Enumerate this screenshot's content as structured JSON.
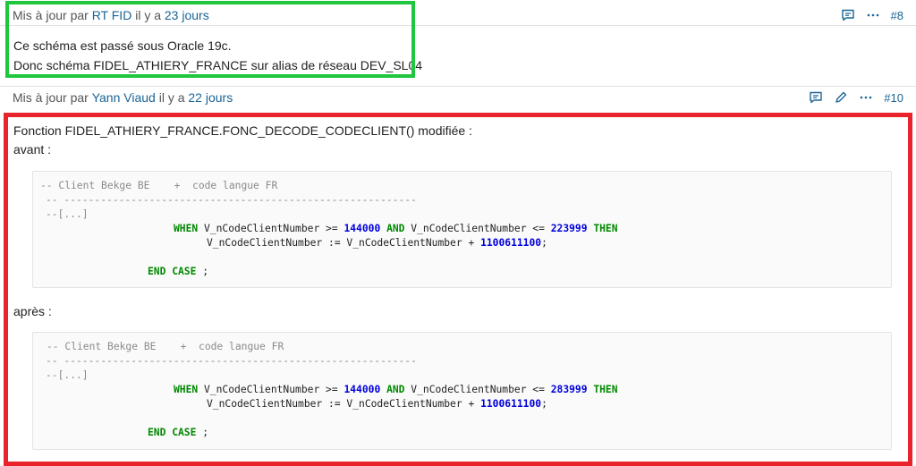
{
  "note8": {
    "prefix": "Mis à jour par",
    "author": "RT FID",
    "ago_prefix": "il y a",
    "ago": "23 jours",
    "number": "#8",
    "lines": [
      "Ce schéma est passé sous Oracle 19c.",
      "Donc schéma FIDEL_ATHIERY_FRANCE sur alias de réseau DEV_SL04"
    ]
  },
  "note10": {
    "prefix": "Mis à jour par",
    "author": "Yann Viaud",
    "ago_prefix": "il y a",
    "ago": "22 jours",
    "number": "#10",
    "intro1": "Fonction FIDEL_ATHIERY_FRANCE.FONC_DECODE_CODECLIENT() modifiée :",
    "avant": "avant :",
    "apres": "après :",
    "code_before": {
      "comment": "-- Client Bekge BE    +  code langue FR",
      "dashes": "-- ----------------------------------------------------------",
      "ellipsis": "--[...]",
      "when_kw": "WHEN",
      "cond1": " V_nCodeClientNumber >= ",
      "n1": "144000",
      "and_kw": " AND",
      "cond2": " V_nCodeClientNumber <= ",
      "n2": "223999",
      "then_kw": " THEN",
      "assign": "V_nCodeClientNumber := V_nCodeClientNumber + ",
      "n3": "1100611100",
      "semi": ";",
      "end_kw": "END CASE",
      "end_semi": " ;"
    },
    "code_after": {
      "comment": "-- Client Bekge BE    +  code langue FR",
      "dashes": "-- ----------------------------------------------------------",
      "ellipsis": "--[...]",
      "when_kw": "WHEN",
      "cond1": " V_nCodeClientNumber >= ",
      "n1": "144000",
      "and_kw": " AND",
      "cond2": " V_nCodeClientNumber <= ",
      "n2": "283999",
      "then_kw": " THEN",
      "assign": "V_nCodeClientNumber := V_nCodeClientNumber + ",
      "n3": "1100611100",
      "semi": ";",
      "end_kw": "END CASE",
      "end_semi": " ;"
    }
  },
  "colors": {
    "highlight_green": "#1fc63e",
    "highlight_red": "#e8232b",
    "link": "#1a6496"
  }
}
